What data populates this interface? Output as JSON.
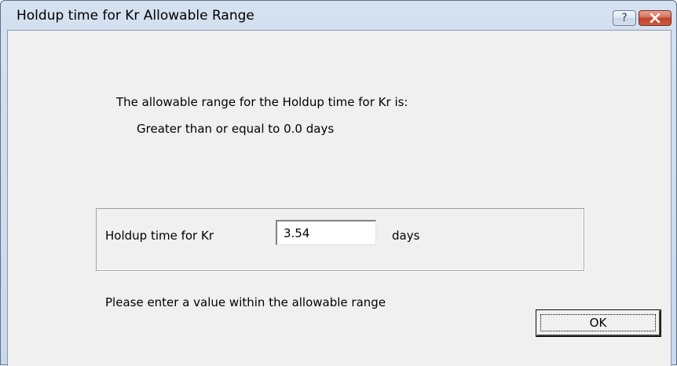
{
  "window": {
    "title": "Holdup time for Kr Allowable Range",
    "help_label": "?",
    "close_icon": "close-x-icon"
  },
  "info": {
    "line1": "The allowable range for the Holdup time for Kr is:",
    "line2": "Greater than or equal to 0.0 days"
  },
  "field": {
    "label": "Holdup time for Kr",
    "value": "3.54",
    "unit": "days"
  },
  "footer": {
    "message": "Please enter a value within the allowable range",
    "ok_label": "OK"
  }
}
